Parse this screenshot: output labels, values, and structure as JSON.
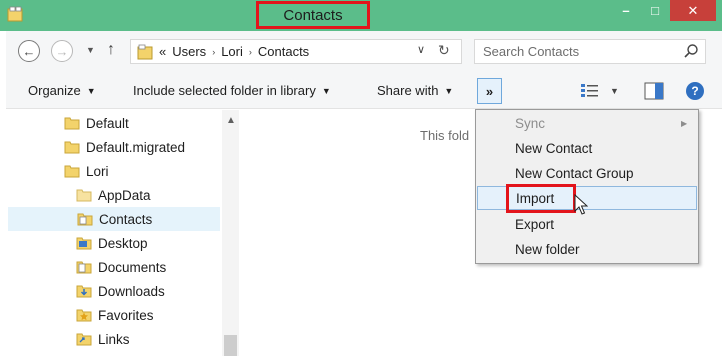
{
  "window": {
    "title": "Contacts",
    "titlebar_color": "#5bbd8a",
    "highlight_color": "#e3141b",
    "controls": {
      "minimize": "–",
      "maximize": "□",
      "close": "✕"
    }
  },
  "navigation": {
    "back_icon": "←",
    "forward_icon": "→",
    "recent_icon": "▼",
    "up_icon": "↑",
    "breadcrumb": {
      "overflow": "«",
      "items": [
        "Users",
        "Lori",
        "Contacts"
      ],
      "separator": "›"
    },
    "dropdown_icon": "∨",
    "refresh_icon": "↻"
  },
  "search": {
    "placeholder": "Search Contacts"
  },
  "toolbar": {
    "organize": "Organize",
    "include": "Include selected folder in library",
    "share": "Share with",
    "caret": "▼",
    "more": "»",
    "help": "?"
  },
  "nav_tree": {
    "items": [
      {
        "label": "Default"
      },
      {
        "label": "Default.migrated"
      },
      {
        "label": "Lori"
      },
      {
        "label": "AppData"
      },
      {
        "label": "Contacts",
        "selected": true
      },
      {
        "label": "Desktop"
      },
      {
        "label": "Documents"
      },
      {
        "label": "Downloads"
      },
      {
        "label": "Favorites"
      },
      {
        "label": "Links"
      }
    ],
    "scroll_up_icon": "▲"
  },
  "content": {
    "empty_message": "This fold"
  },
  "context_menu": {
    "items": [
      {
        "label": "Sync",
        "disabled": true,
        "submenu_icon": "▶"
      },
      {
        "label": "New Contact"
      },
      {
        "label": "New Contact Group"
      },
      {
        "label": "Import",
        "hover": true
      },
      {
        "label": "Export"
      },
      {
        "label": "New folder"
      }
    ]
  }
}
